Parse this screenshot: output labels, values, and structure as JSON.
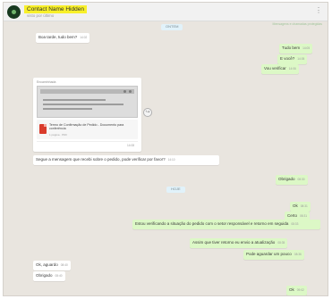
{
  "header": {
    "contact_name": "Contact Name Hidden",
    "status": "visto por último",
    "menu_icon": "⋮",
    "pin_note": "Mensagens e chamadas protegidas"
  },
  "day_chips": [
    "ONTEM",
    "HOJE"
  ],
  "messages": [
    {
      "dir": "in",
      "text": "Boa tarde, tudo bem?",
      "time": "14:02"
    },
    {
      "dir": "out",
      "text": "Tudo bem",
      "time": "14:05"
    },
    {
      "dir": "out",
      "text": "E você?",
      "time": "14:05"
    },
    {
      "dir": "out",
      "text": "Vou verificar",
      "time": "14:06"
    },
    {
      "dir": "in",
      "text": "Segue a mensagem que recebi sobre o pedido, pode verificar por favor?",
      "time": "14:10"
    },
    {
      "dir": "out",
      "text": "Obrigado",
      "time": "08:30"
    },
    {
      "dir": "out",
      "text": "Ok",
      "time": "08:31"
    },
    {
      "dir": "out",
      "text": "Certo",
      "time": "08:31"
    },
    {
      "dir": "out",
      "text": "Estou verificando a situação do pedido com o setor responsável e retorno em seguida",
      "time": "08:33"
    },
    {
      "dir": "out",
      "text": "Assim que tiver retorno eu envio a atualização",
      "time": "08:35"
    },
    {
      "dir": "out",
      "text": "Pode aguardar um pouco",
      "time": "08:36"
    },
    {
      "dir": "in",
      "text": "Ok, aguardo",
      "time": "08:40"
    },
    {
      "dir": "in",
      "text": "Obrigado",
      "time": "08:40"
    },
    {
      "dir": "out",
      "text": "Ok",
      "time": "09:02"
    }
  ],
  "shared_card": {
    "sender": "Encaminhada",
    "doc_title": "Termo de Confirmação de Pedido - Documento para conferência",
    "doc_sub": "1 página · PDF",
    "time": "14:08",
    "forward_icon": "↪"
  },
  "colors": {
    "chat_bg": "#e9e5df",
    "outgoing": "#dcf8c6",
    "incoming": "#ffffff",
    "highlight": "#f8f02a"
  }
}
